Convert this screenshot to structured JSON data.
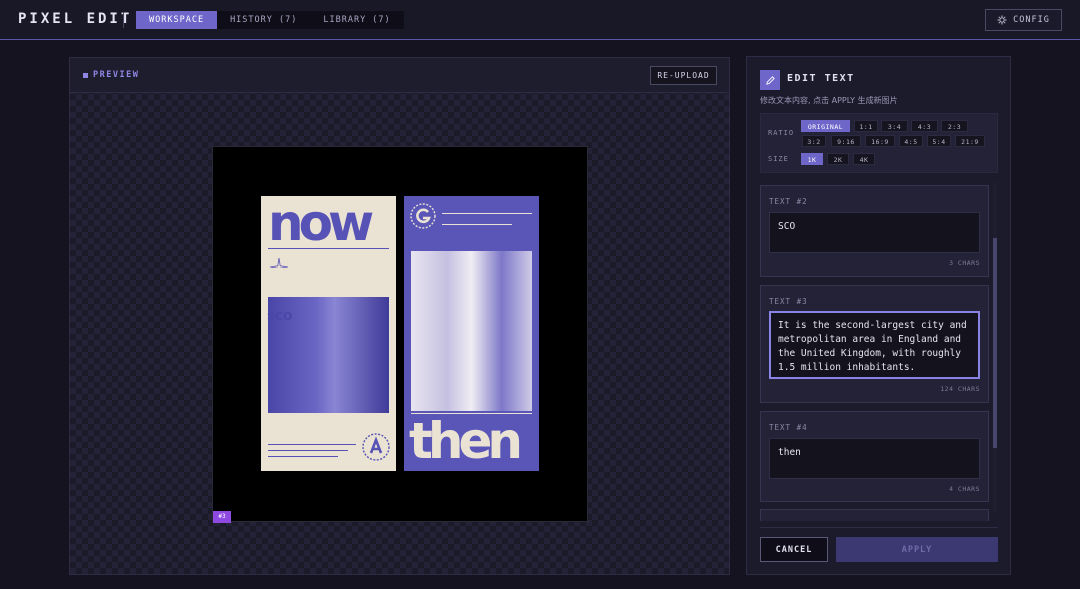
{
  "header": {
    "brand": "PIXEL EDIT",
    "tabs": [
      {
        "label": "WORKSPACE",
        "active": true
      },
      {
        "label": "HISTORY (7)",
        "active": false
      },
      {
        "label": "LIBRARY (7)",
        "active": false
      }
    ],
    "config_label": "CONFIG"
  },
  "preview": {
    "title": "PREVIEW",
    "reupload_label": "RE-UPLOAD",
    "layer_tag": "#3",
    "poster_left": {
      "headline": "now",
      "overlay": "SCO"
    },
    "poster_right": {
      "headline": "then"
    }
  },
  "edit": {
    "title": "EDIT TEXT",
    "subtitle": "修改文本内容, 点击 APPLY 生成新图片",
    "ratio_label": "RATIO",
    "ratios": [
      "ORIGINAL",
      "1:1",
      "3:4",
      "4:3",
      "2:3",
      "3:2",
      "9:16",
      "16:9",
      "4:5",
      "5:4",
      "21:9"
    ],
    "ratio_selected": "ORIGINAL",
    "size_label": "SIZE",
    "sizes": [
      "1K",
      "2K",
      "4K"
    ],
    "size_selected": "1K",
    "texts": [
      {
        "label": "TEXT #2",
        "value": "SCO",
        "count": "3 CHARS"
      },
      {
        "label": "TEXT #3",
        "value": "It is the second-largest city and metropolitan area in England and the United Kingdom, with roughly 1.5 million inhabitants.",
        "count": "124 CHARS"
      },
      {
        "label": "TEXT #4",
        "value": "then",
        "count": "4 CHARS"
      }
    ],
    "cancel_label": "CANCEL",
    "apply_label": "APPLY"
  },
  "colors": {
    "accent": "#6e67c9",
    "background": "#14131f",
    "poster_blue": "#5a56b8",
    "poster_cream": "#eae2d3"
  }
}
